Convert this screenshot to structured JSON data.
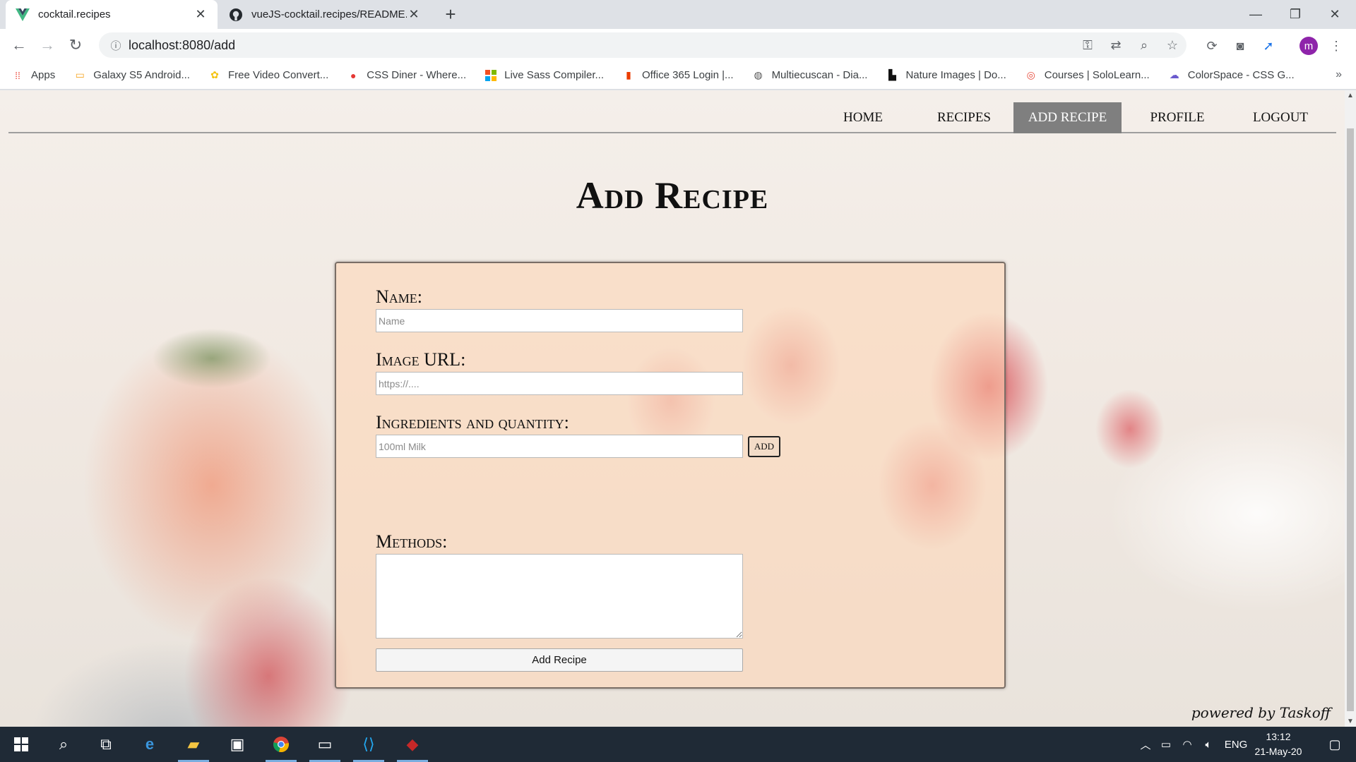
{
  "browser": {
    "tabs": [
      {
        "title": "cocktail.recipes",
        "active": true
      },
      {
        "title": "vueJS-cocktail.recipes/README.m",
        "active": false
      }
    ],
    "url": "localhost:8080/add",
    "profile_initial": "m"
  },
  "bookmarks": [
    {
      "label": "Apps",
      "icon": "apps-grid-icon",
      "color": "#ea4335"
    },
    {
      "label": "Galaxy S5 Android...",
      "icon": "android-icon",
      "color": "#f6a623"
    },
    {
      "label": "Free Video Convert...",
      "icon": "video-convert-icon",
      "color": "#f4c20d"
    },
    {
      "label": "CSS Diner - Where...",
      "icon": "css-diner-icon",
      "color": "#e53935"
    },
    {
      "label": "Live Sass Compiler...",
      "icon": "microsoft-icon",
      "color": "#00a4ef"
    },
    {
      "label": "Office 365 Login |...",
      "icon": "office-icon",
      "color": "#eb3c00"
    },
    {
      "label": "Multiecuscan - Dia...",
      "icon": "multiecuscan-icon",
      "color": "#555555"
    },
    {
      "label": "Nature Images | Do...",
      "icon": "unsplash-icon",
      "color": "#111111"
    },
    {
      "label": "Courses | SoloLearn...",
      "icon": "sololearn-icon",
      "color": "#e84c3d"
    },
    {
      "label": "ColorSpace - CSS G...",
      "icon": "colorspace-icon",
      "color": "#6a5acd"
    }
  ],
  "nav": {
    "home": "HOME",
    "recipes": "RECIPES",
    "add_recipe": "ADD RECIPE",
    "profile": "PROFILE",
    "logout": "LOGOUT"
  },
  "page": {
    "title": "Add Recipe",
    "powered_by": "powered by Taskoff"
  },
  "form": {
    "name_label": "Name:",
    "name_placeholder": "Name",
    "image_label": "Image URL:",
    "image_placeholder": "https://....",
    "ingredients_label": "Ingredients and quantity:",
    "ingredients_placeholder": "100ml Milk",
    "add_button": "ADD",
    "methods_label": "Methods:",
    "submit_button": "Add Recipe"
  },
  "taskbar": {
    "language": "ENG",
    "time": "13:12",
    "date": "21-May-20"
  },
  "colors": {
    "nav_active_bg": "#7f7f7f",
    "panel_bg": "#ffd6b4",
    "taskbar_bg": "#1f2a36"
  }
}
